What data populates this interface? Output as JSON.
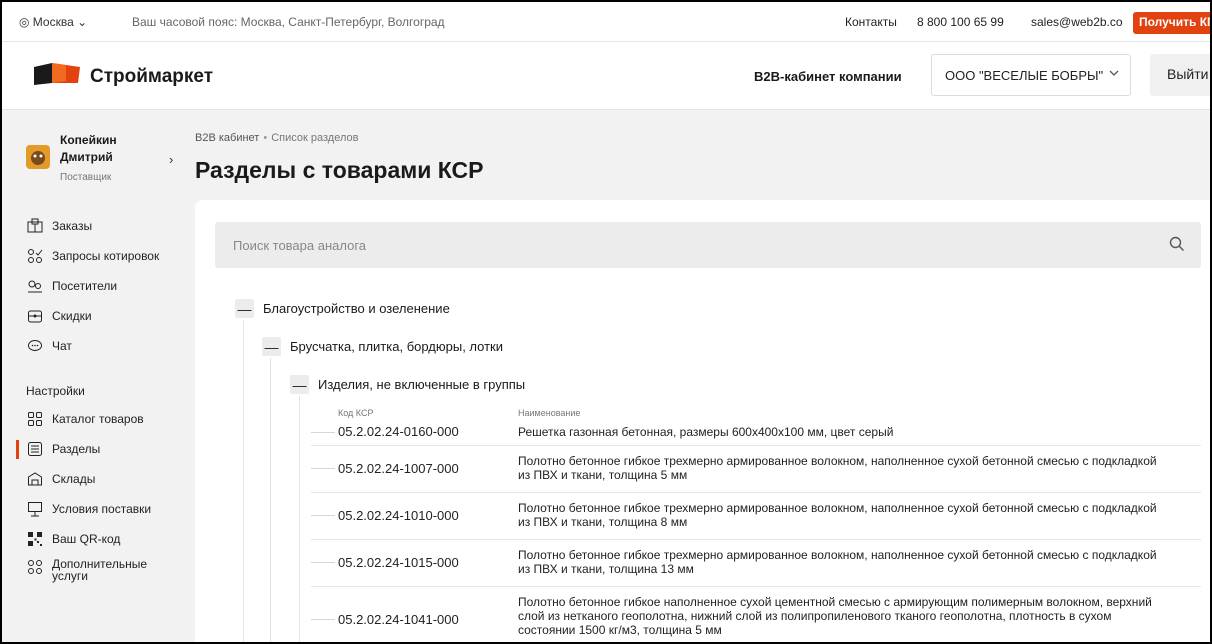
{
  "topbar": {
    "city": "◎ Москва ⌄",
    "timezone": "Ваш часовой пояс: Москва, Санкт-Петербург, Волгоград",
    "contacts": "Контакты",
    "phone": "8 800 100 65 99",
    "email": "sales@web2b.co",
    "kp_button": "Получить КП"
  },
  "header": {
    "logo_text": "Строймаркет",
    "b2b_label": "B2B-кабинет компании",
    "company": "ООО \"ВЕСЕЛЫЕ БОБРЫ\"",
    "logout": "Выйти",
    "accent_color": "#e2420f"
  },
  "user": {
    "last_name": "Копейкин",
    "first_name": "Дмитрий",
    "role": "Поставщик"
  },
  "sidebar": {
    "items": [
      {
        "label": "Заказы",
        "icon": "orders-icon"
      },
      {
        "label": "Запросы котировок",
        "icon": "quotes-icon"
      },
      {
        "label": "Посетители",
        "icon": "visitors-icon"
      },
      {
        "label": "Скидки",
        "icon": "discount-icon"
      },
      {
        "label": "Чат",
        "icon": "chat-icon"
      }
    ],
    "settings_title": "Настройки",
    "settings_items": [
      {
        "label": "Каталог товаров",
        "icon": "catalog-icon"
      },
      {
        "label": "Разделы",
        "icon": "sections-icon",
        "active": true
      },
      {
        "label": "Склады",
        "icon": "warehouse-icon"
      },
      {
        "label": "Условия поставки",
        "icon": "delivery-icon"
      },
      {
        "label": "Ваш QR-код",
        "icon": "qr-icon"
      },
      {
        "label": "Дополнительные",
        "label2": "услуги",
        "icon": "services-icon"
      }
    ]
  },
  "breadcrumb": {
    "root": "B2B кабинет",
    "sep": "•",
    "current": "Список разделов"
  },
  "page_title": "Разделы с товарами КСР",
  "search": {
    "placeholder": "Поиск товара аналога"
  },
  "tree": {
    "level1": "Благоустройство и озеленение",
    "level2": "Брусчатка, плитка, бордюры, лотки",
    "level3": "Изделия, не включенные в группы",
    "toggle_symbol": "—",
    "col_code": "Код КСР",
    "col_name": "Наименование",
    "items": [
      {
        "code": "05.2.02.24-0160-000",
        "name": "Решетка газонная бетонная, размеры 600x400x100 мм, цвет серый"
      },
      {
        "code": "05.2.02.24-1007-000",
        "name": "Полотно бетонное гибкое трехмерно армированное волокном, наполненное сухой бетонной смесью с подкладкой из ПВХ и ткани, толщина 5 мм"
      },
      {
        "code": "05.2.02.24-1010-000",
        "name": "Полотно бетонное гибкое трехмерно армированное волокном, наполненное сухой бетонной смесью с подкладкой из ПВХ и ткани, толщина 8 мм"
      },
      {
        "code": "05.2.02.24-1015-000",
        "name": "Полотно бетонное гибкое трехмерно армированное волокном, наполненное сухой бетонной смесью с подкладкой из ПВХ и ткани, толщина 13 мм"
      },
      {
        "code": "05.2.02.24-1041-000",
        "name": "Полотно бетонное гибкое наполненное сухой цементной смесью с армирующим полимерным волокном, верхний слой из нетканого геополотна, нижний слой из полипропиленового тканого геополотна, плотность в сухом состоянии 1500 кг/м3, толщина 5 мм"
      }
    ]
  }
}
